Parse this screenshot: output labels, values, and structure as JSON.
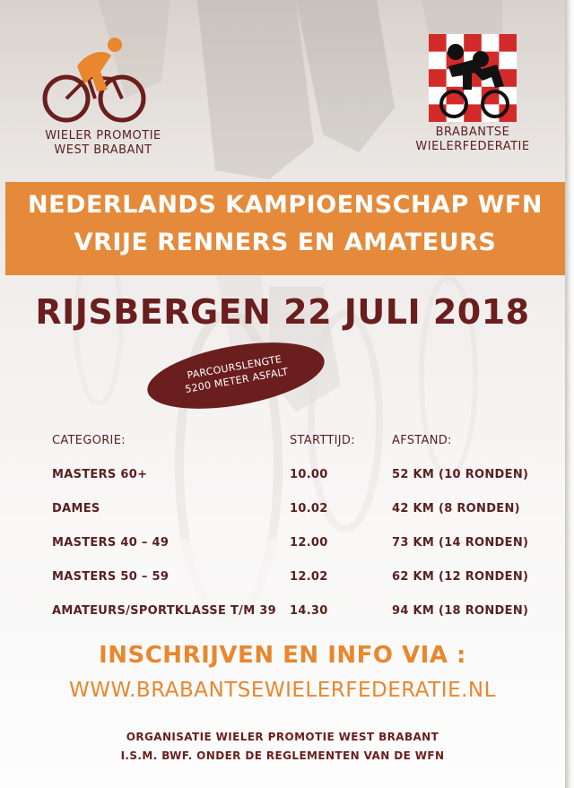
{
  "logos": {
    "left": {
      "icon": "cyclist-icon",
      "line1": "WIELER PROMOTIE",
      "line2": "WEST BRABANT"
    },
    "right": {
      "icon": "checkered-cyclist-icon",
      "line1": "BRABANTSE",
      "line2": "WIELERFEDERATIE"
    }
  },
  "banner": {
    "line1": "NEDERLANDS KAMPIOENSCHAP WFN",
    "line2": "VRIJE RENNERS EN AMATEURS",
    "color": "#e58a3a"
  },
  "event_title": "RIJSBERGEN 22 JULI 2018",
  "course": {
    "line1": "PARCOURSLENGTE",
    "line2": "5200 METER ASFALT"
  },
  "schedule": {
    "headers": [
      "CATEGORIE:",
      "STARTTIJD:",
      "AFSTAND:"
    ],
    "rows": [
      {
        "category": "MASTERS 60+",
        "start": "10.00",
        "distance": "52 KM (10 RONDEN)"
      },
      {
        "category": "DAMES",
        "start": "10.02",
        "distance": "42 KM (8 RONDEN)"
      },
      {
        "category": "MASTERS 40 – 49",
        "start": "12.00",
        "distance": "73 KM (14 RONDEN)"
      },
      {
        "category": "MASTERS 50 – 59",
        "start": "12.02",
        "distance": "62 KM (12 RONDEN)"
      },
      {
        "category": "AMATEURS/SPORTKLASSE T/M 39",
        "start": "14.30",
        "distance": "94 KM (18 RONDEN)"
      }
    ]
  },
  "info_heading": "INSCHRIJVEN EN INFO VIA :",
  "info_url": "WWW.BRABANTSEWIELERFEDERATIE.NL",
  "footer": {
    "line1": "ORGANISATIE WIELER PROMOTIE WEST BRABANT",
    "line2": "I.S.M. BWF.  ONDER DE REGLEMENTEN VAN DE WFN"
  },
  "colors": {
    "brand_orange": "#e8872e",
    "brand_maroon": "#6b1e1e"
  }
}
